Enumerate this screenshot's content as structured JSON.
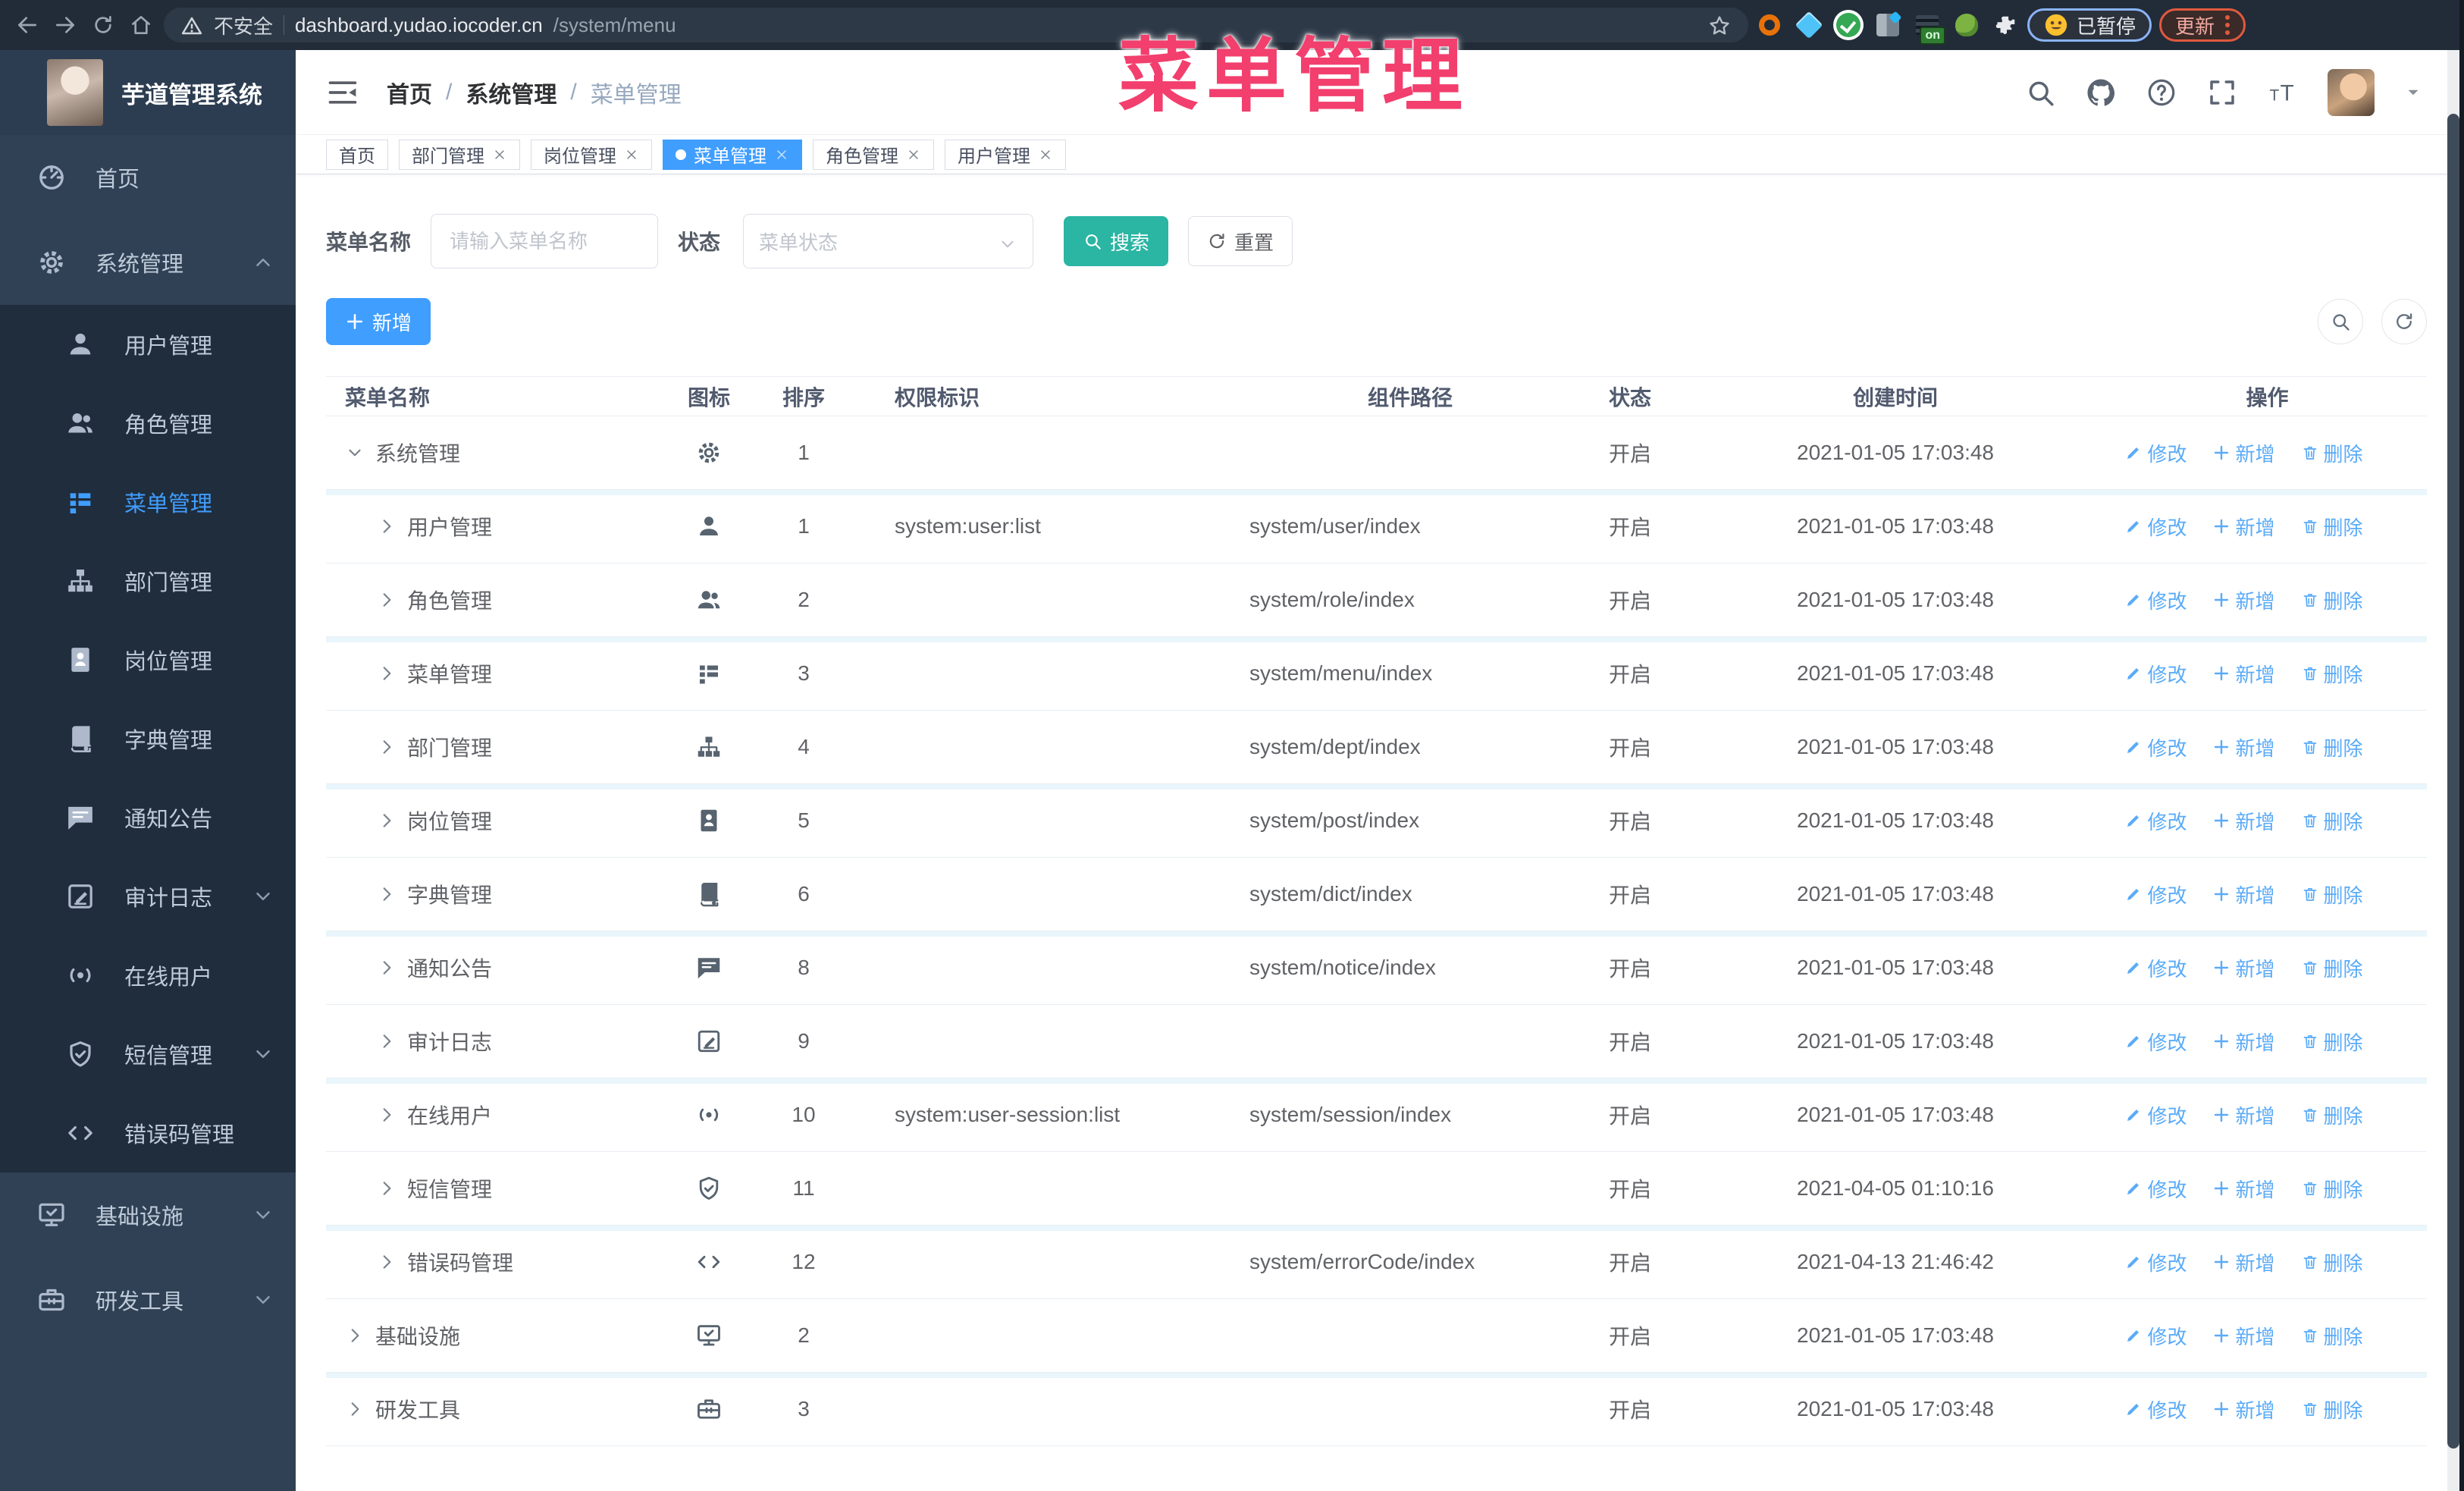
{
  "browser": {
    "nav_icons": [
      "back",
      "forward",
      "reload",
      "home"
    ],
    "security_label": "不安全",
    "url_domain": "dashboard.yudao.iocoder.cn",
    "url_path": "/system/menu",
    "bookmark_icon": "star",
    "extensions": [
      "orange-ring-extension",
      "blue-gem-extension",
      "green-check-extension",
      "columns-extension",
      "dark-on-extension",
      "green-animal-extension",
      "puzzle-extensions-menu"
    ],
    "extension_on_badge": "on",
    "paused_pill_label": "已暂停",
    "update_pill_label": "更新"
  },
  "overlay_title": "菜单管理",
  "logo": {
    "title": "芋道管理系统"
  },
  "breadcrumb": [
    "首页",
    "系统管理",
    "菜单管理"
  ],
  "header_icons": [
    "search",
    "github",
    "question",
    "expand",
    "fontsize"
  ],
  "sidebar": [
    {
      "label": "首页",
      "icon": "dashboard",
      "level": 0,
      "active": false,
      "chevron": null
    },
    {
      "label": "系统管理",
      "icon": "gear",
      "level": 0,
      "active": false,
      "chevron": "up"
    },
    {
      "label": "用户管理",
      "icon": "user",
      "level": 1,
      "active": false,
      "chevron": null
    },
    {
      "label": "角色管理",
      "icon": "users",
      "level": 1,
      "active": false,
      "chevron": null
    },
    {
      "label": "菜单管理",
      "icon": "menulist",
      "level": 1,
      "active": true,
      "chevron": null
    },
    {
      "label": "部门管理",
      "icon": "sitemap",
      "level": 1,
      "active": false,
      "chevron": null
    },
    {
      "label": "岗位管理",
      "icon": "badge",
      "level": 1,
      "active": false,
      "chevron": null
    },
    {
      "label": "字典管理",
      "icon": "book",
      "level": 1,
      "active": false,
      "chevron": null
    },
    {
      "label": "通知公告",
      "icon": "chat",
      "level": 1,
      "active": false,
      "chevron": null
    },
    {
      "label": "审计日志",
      "icon": "editnote",
      "level": 1,
      "active": false,
      "chevron": "down"
    },
    {
      "label": "在线用户",
      "icon": "online",
      "level": 1,
      "active": false,
      "chevron": null
    },
    {
      "label": "短信管理",
      "icon": "shield",
      "level": 1,
      "active": false,
      "chevron": "down"
    },
    {
      "label": "错误码管理",
      "icon": "code",
      "level": 1,
      "active": false,
      "chevron": null
    },
    {
      "label": "基础设施",
      "icon": "monitor",
      "level": 0,
      "active": false,
      "chevron": "down"
    },
    {
      "label": "研发工具",
      "icon": "toolbox",
      "level": 0,
      "active": false,
      "chevron": "down"
    }
  ],
  "tabs": [
    {
      "label": "首页",
      "closable": false,
      "active": false
    },
    {
      "label": "部门管理",
      "closable": true,
      "active": false
    },
    {
      "label": "岗位管理",
      "closable": true,
      "active": false
    },
    {
      "label": "菜单管理",
      "closable": true,
      "active": true
    },
    {
      "label": "角色管理",
      "closable": true,
      "active": false
    },
    {
      "label": "用户管理",
      "closable": true,
      "active": false
    }
  ],
  "filters": {
    "name_label": "菜单名称",
    "name_placeholder": "请输入菜单名称",
    "name_value": "",
    "status_label": "状态",
    "status_placeholder": "菜单状态",
    "search_label": "搜索",
    "reset_label": "重置"
  },
  "toolbar": {
    "add_label": "新增",
    "right_icons": [
      "search",
      "refresh"
    ]
  },
  "table": {
    "columns": [
      "菜单名称",
      "图标",
      "排序",
      "权限标识",
      "组件路径",
      "状态",
      "创建时间",
      "操作"
    ],
    "action_labels": {
      "edit": "修改",
      "add": "新增",
      "delete": "删除"
    },
    "rows": [
      {
        "name": "系统管理",
        "icon": "gear",
        "level": 0,
        "expanded": true,
        "sort": "1",
        "perm": "",
        "path": "",
        "status": "开启",
        "time": "2021-01-05 17:03:48"
      },
      {
        "name": "用户管理",
        "icon": "user",
        "level": 1,
        "expanded": false,
        "sort": "1",
        "perm": "system:user:list",
        "path": "system/user/index",
        "status": "开启",
        "time": "2021-01-05 17:03:48"
      },
      {
        "name": "角色管理",
        "icon": "users",
        "level": 1,
        "expanded": false,
        "sort": "2",
        "perm": "",
        "path": "system/role/index",
        "status": "开启",
        "time": "2021-01-05 17:03:48"
      },
      {
        "name": "菜单管理",
        "icon": "menulist",
        "level": 1,
        "expanded": false,
        "sort": "3",
        "perm": "",
        "path": "system/menu/index",
        "status": "开启",
        "time": "2021-01-05 17:03:48"
      },
      {
        "name": "部门管理",
        "icon": "sitemap",
        "level": 1,
        "expanded": false,
        "sort": "4",
        "perm": "",
        "path": "system/dept/index",
        "status": "开启",
        "time": "2021-01-05 17:03:48"
      },
      {
        "name": "岗位管理",
        "icon": "badge",
        "level": 1,
        "expanded": false,
        "sort": "5",
        "perm": "",
        "path": "system/post/index",
        "status": "开启",
        "time": "2021-01-05 17:03:48"
      },
      {
        "name": "字典管理",
        "icon": "book",
        "level": 1,
        "expanded": false,
        "sort": "6",
        "perm": "",
        "path": "system/dict/index",
        "status": "开启",
        "time": "2021-01-05 17:03:48"
      },
      {
        "name": "通知公告",
        "icon": "chat",
        "level": 1,
        "expanded": false,
        "sort": "8",
        "perm": "",
        "path": "system/notice/index",
        "status": "开启",
        "time": "2021-01-05 17:03:48"
      },
      {
        "name": "审计日志",
        "icon": "editnote",
        "level": 1,
        "expanded": false,
        "sort": "9",
        "perm": "",
        "path": "",
        "status": "开启",
        "time": "2021-01-05 17:03:48"
      },
      {
        "name": "在线用户",
        "icon": "online",
        "level": 1,
        "expanded": false,
        "sort": "10",
        "perm": "system:user-session:list",
        "path": "system/session/index",
        "status": "开启",
        "time": "2021-01-05 17:03:48"
      },
      {
        "name": "短信管理",
        "icon": "shield",
        "level": 1,
        "expanded": false,
        "sort": "11",
        "perm": "",
        "path": "",
        "status": "开启",
        "time": "2021-04-05 01:10:16"
      },
      {
        "name": "错误码管理",
        "icon": "code",
        "level": 1,
        "expanded": false,
        "sort": "12",
        "perm": "",
        "path": "system/errorCode/index",
        "status": "开启",
        "time": "2021-04-13 21:46:42"
      },
      {
        "name": "基础设施",
        "icon": "monitor",
        "level": 0,
        "expanded": false,
        "sort": "2",
        "perm": "",
        "path": "",
        "status": "开启",
        "time": "2021-01-05 17:03:48"
      },
      {
        "name": "研发工具",
        "icon": "toolbox",
        "level": 0,
        "expanded": false,
        "sort": "3",
        "perm": "",
        "path": "",
        "status": "开启",
        "time": "2021-01-05 17:03:48"
      }
    ]
  }
}
